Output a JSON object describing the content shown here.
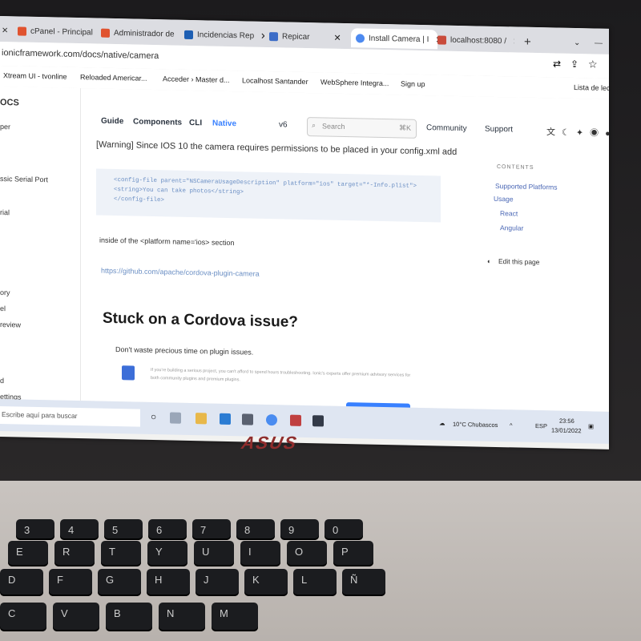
{
  "browser": {
    "tabs": [
      {
        "label": "cPanel - Principal",
        "color": "#e0532f"
      },
      {
        "label": "Administrador de",
        "color": "#e0532f"
      },
      {
        "label": "Incidencias Rep",
        "color": "#1e5fb3"
      },
      {
        "label": "Repicar",
        "color": "#3b6cc7"
      },
      {
        "label": "Install Camera | I",
        "color": "#4d8af0"
      },
      {
        "label": "localhost:8080 / ",
        "color": "#c94b3b"
      }
    ],
    "url": "ionicframework.com/docs/native/camera",
    "bookmarks": [
      "Xtream UI - tvonline",
      "Reloaded Americar...",
      "Acceder › Master d...",
      "Localhost Santander",
      "WebSphere Integra...",
      "Sign up",
      "Lista de lect"
    ]
  },
  "docs": {
    "logo": "OCS",
    "nav": [
      "Guide",
      "Components",
      "CLI",
      "Native"
    ],
    "version": "v6",
    "search_placeholder": "Search",
    "search_shortcut": "⌘K",
    "community": "Community",
    "support": "Support",
    "sidebar": [
      "per",
      "ssic Serial Port",
      "rial",
      "ory",
      "el",
      "review",
      "d",
      "ettings"
    ],
    "warning": "[Warning] Since IOS 10 the camera requires permissions to be placed in your config.xml add",
    "code_lines": [
      "<config-file parent=\"NSCameraUsageDescription\" platform=\"ios\" target=\"*-Info.plist\">",
      "  <string>You can take photos</string>",
      "</config-file>"
    ],
    "inside_text": "inside of the <platform name='ios> section",
    "repo_link": "https://github.com/apache/cordova-plugin-camera",
    "heading": "Stuck on a Cordova issue?",
    "subtext": "Don't waste precious time on plugin issues.",
    "promo_text": "If you're building a serious project, you can't afford to spend hours troubleshooting. Ionic's experts offer premium advisory services for both community plugins and premium plugins.",
    "cta": "Contact Us Today!",
    "toc_title": "CONTENTS",
    "toc": [
      "Supported Platforms",
      "Usage",
      "React",
      "Angular"
    ],
    "edit_link": "Edit this page"
  },
  "taskbar": {
    "search": "Escribe aquí para buscar",
    "weather": "10°C Chubascos",
    "lang": "ESP",
    "time": "23:56",
    "date": "13/01/2022"
  },
  "laptop": {
    "brand": "ASUS",
    "keys_row1": [
      "3",
      "4",
      "5",
      "6",
      "7",
      "8",
      "9",
      "0"
    ],
    "keys_row2": [
      "E",
      "R",
      "T",
      "Y",
      "U",
      "I",
      "O",
      "P"
    ],
    "keys_row3": [
      "D",
      "F",
      "G",
      "H",
      "J",
      "K",
      "L",
      "Ñ"
    ],
    "keys_row4": [
      "C",
      "V",
      "B",
      "N",
      "M"
    ]
  }
}
